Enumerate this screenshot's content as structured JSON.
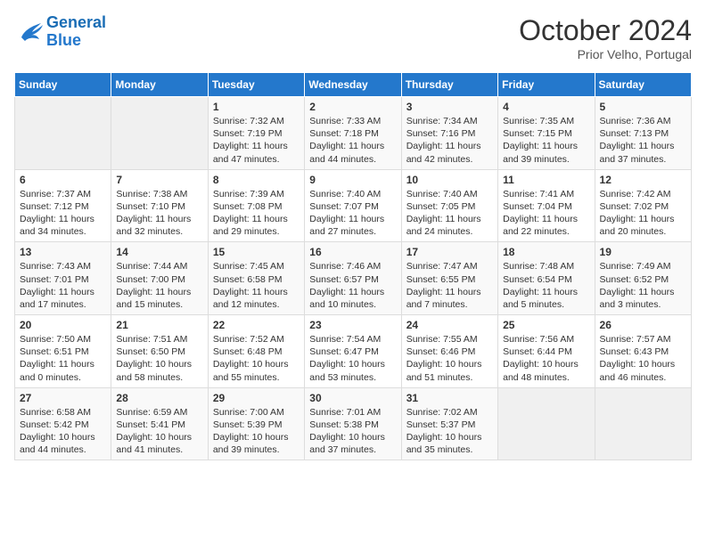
{
  "header": {
    "logo_line1": "General",
    "logo_line2": "Blue",
    "month": "October 2024",
    "location": "Prior Velho, Portugal"
  },
  "days_of_week": [
    "Sunday",
    "Monday",
    "Tuesday",
    "Wednesday",
    "Thursday",
    "Friday",
    "Saturday"
  ],
  "weeks": [
    [
      {
        "day": "",
        "info": ""
      },
      {
        "day": "",
        "info": ""
      },
      {
        "day": "1",
        "info": "Sunrise: 7:32 AM\nSunset: 7:19 PM\nDaylight: 11 hours and 47 minutes."
      },
      {
        "day": "2",
        "info": "Sunrise: 7:33 AM\nSunset: 7:18 PM\nDaylight: 11 hours and 44 minutes."
      },
      {
        "day": "3",
        "info": "Sunrise: 7:34 AM\nSunset: 7:16 PM\nDaylight: 11 hours and 42 minutes."
      },
      {
        "day": "4",
        "info": "Sunrise: 7:35 AM\nSunset: 7:15 PM\nDaylight: 11 hours and 39 minutes."
      },
      {
        "day": "5",
        "info": "Sunrise: 7:36 AM\nSunset: 7:13 PM\nDaylight: 11 hours and 37 minutes."
      }
    ],
    [
      {
        "day": "6",
        "info": "Sunrise: 7:37 AM\nSunset: 7:12 PM\nDaylight: 11 hours and 34 minutes."
      },
      {
        "day": "7",
        "info": "Sunrise: 7:38 AM\nSunset: 7:10 PM\nDaylight: 11 hours and 32 minutes."
      },
      {
        "day": "8",
        "info": "Sunrise: 7:39 AM\nSunset: 7:08 PM\nDaylight: 11 hours and 29 minutes."
      },
      {
        "day": "9",
        "info": "Sunrise: 7:40 AM\nSunset: 7:07 PM\nDaylight: 11 hours and 27 minutes."
      },
      {
        "day": "10",
        "info": "Sunrise: 7:40 AM\nSunset: 7:05 PM\nDaylight: 11 hours and 24 minutes."
      },
      {
        "day": "11",
        "info": "Sunrise: 7:41 AM\nSunset: 7:04 PM\nDaylight: 11 hours and 22 minutes."
      },
      {
        "day": "12",
        "info": "Sunrise: 7:42 AM\nSunset: 7:02 PM\nDaylight: 11 hours and 20 minutes."
      }
    ],
    [
      {
        "day": "13",
        "info": "Sunrise: 7:43 AM\nSunset: 7:01 PM\nDaylight: 11 hours and 17 minutes."
      },
      {
        "day": "14",
        "info": "Sunrise: 7:44 AM\nSunset: 7:00 PM\nDaylight: 11 hours and 15 minutes."
      },
      {
        "day": "15",
        "info": "Sunrise: 7:45 AM\nSunset: 6:58 PM\nDaylight: 11 hours and 12 minutes."
      },
      {
        "day": "16",
        "info": "Sunrise: 7:46 AM\nSunset: 6:57 PM\nDaylight: 11 hours and 10 minutes."
      },
      {
        "day": "17",
        "info": "Sunrise: 7:47 AM\nSunset: 6:55 PM\nDaylight: 11 hours and 7 minutes."
      },
      {
        "day": "18",
        "info": "Sunrise: 7:48 AM\nSunset: 6:54 PM\nDaylight: 11 hours and 5 minutes."
      },
      {
        "day": "19",
        "info": "Sunrise: 7:49 AM\nSunset: 6:52 PM\nDaylight: 11 hours and 3 minutes."
      }
    ],
    [
      {
        "day": "20",
        "info": "Sunrise: 7:50 AM\nSunset: 6:51 PM\nDaylight: 11 hours and 0 minutes."
      },
      {
        "day": "21",
        "info": "Sunrise: 7:51 AM\nSunset: 6:50 PM\nDaylight: 10 hours and 58 minutes."
      },
      {
        "day": "22",
        "info": "Sunrise: 7:52 AM\nSunset: 6:48 PM\nDaylight: 10 hours and 55 minutes."
      },
      {
        "day": "23",
        "info": "Sunrise: 7:54 AM\nSunset: 6:47 PM\nDaylight: 10 hours and 53 minutes."
      },
      {
        "day": "24",
        "info": "Sunrise: 7:55 AM\nSunset: 6:46 PM\nDaylight: 10 hours and 51 minutes."
      },
      {
        "day": "25",
        "info": "Sunrise: 7:56 AM\nSunset: 6:44 PM\nDaylight: 10 hours and 48 minutes."
      },
      {
        "day": "26",
        "info": "Sunrise: 7:57 AM\nSunset: 6:43 PM\nDaylight: 10 hours and 46 minutes."
      }
    ],
    [
      {
        "day": "27",
        "info": "Sunrise: 6:58 AM\nSunset: 5:42 PM\nDaylight: 10 hours and 44 minutes."
      },
      {
        "day": "28",
        "info": "Sunrise: 6:59 AM\nSunset: 5:41 PM\nDaylight: 10 hours and 41 minutes."
      },
      {
        "day": "29",
        "info": "Sunrise: 7:00 AM\nSunset: 5:39 PM\nDaylight: 10 hours and 39 minutes."
      },
      {
        "day": "30",
        "info": "Sunrise: 7:01 AM\nSunset: 5:38 PM\nDaylight: 10 hours and 37 minutes."
      },
      {
        "day": "31",
        "info": "Sunrise: 7:02 AM\nSunset: 5:37 PM\nDaylight: 10 hours and 35 minutes."
      },
      {
        "day": "",
        "info": ""
      },
      {
        "day": "",
        "info": ""
      }
    ]
  ]
}
